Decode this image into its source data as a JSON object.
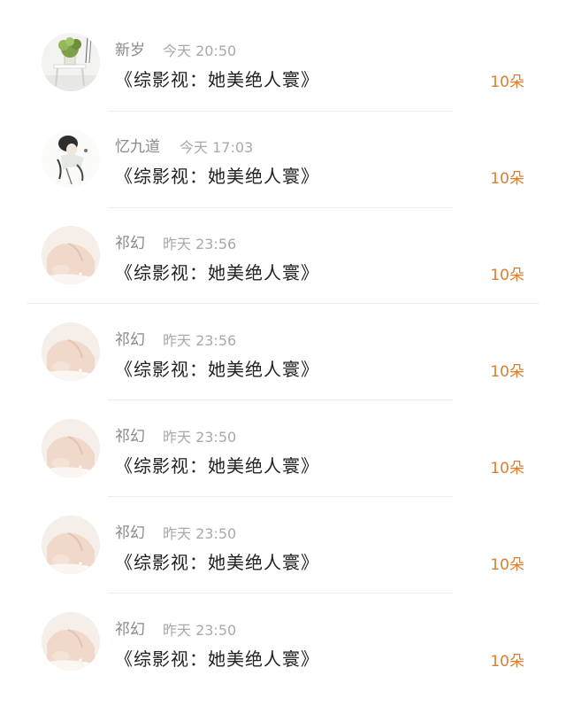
{
  "records": [
    {
      "name": "新岁",
      "time": "今天 20:50",
      "book": "《综影视：她美绝人寰》",
      "gift": "10朵",
      "avatar": "plant-avatar"
    },
    {
      "name": "忆九道",
      "time": "今天 17:03",
      "book": "《综影视：她美绝人寰》",
      "gift": "10朵",
      "avatar": "ink-figure-avatar"
    },
    {
      "name": "祁幻",
      "time": "昨天 23:56",
      "book": "《综影视：她美绝人寰》",
      "gift": "10朵",
      "avatar": "shoulder-avatar"
    },
    {
      "name": "祁幻",
      "time": "昨天 23:56",
      "book": "《综影视：她美绝人寰》",
      "gift": "10朵",
      "avatar": "shoulder-avatar"
    },
    {
      "name": "祁幻",
      "time": "昨天 23:50",
      "book": "《综影视：她美绝人寰》",
      "gift": "10朵",
      "avatar": "shoulder-avatar"
    },
    {
      "name": "祁幻",
      "time": "昨天 23:50",
      "book": "《综影视：她美绝人寰》",
      "gift": "10朵",
      "avatar": "shoulder-avatar"
    },
    {
      "name": "祁幻",
      "time": "昨天 23:50",
      "book": "《综影视：她美绝人寰》",
      "gift": "10朵",
      "avatar": "shoulder-avatar"
    }
  ],
  "colors": {
    "gift": "#e07d2c",
    "name": "#8a8a8a",
    "time": "#a9a9a9",
    "title": "#222222"
  }
}
